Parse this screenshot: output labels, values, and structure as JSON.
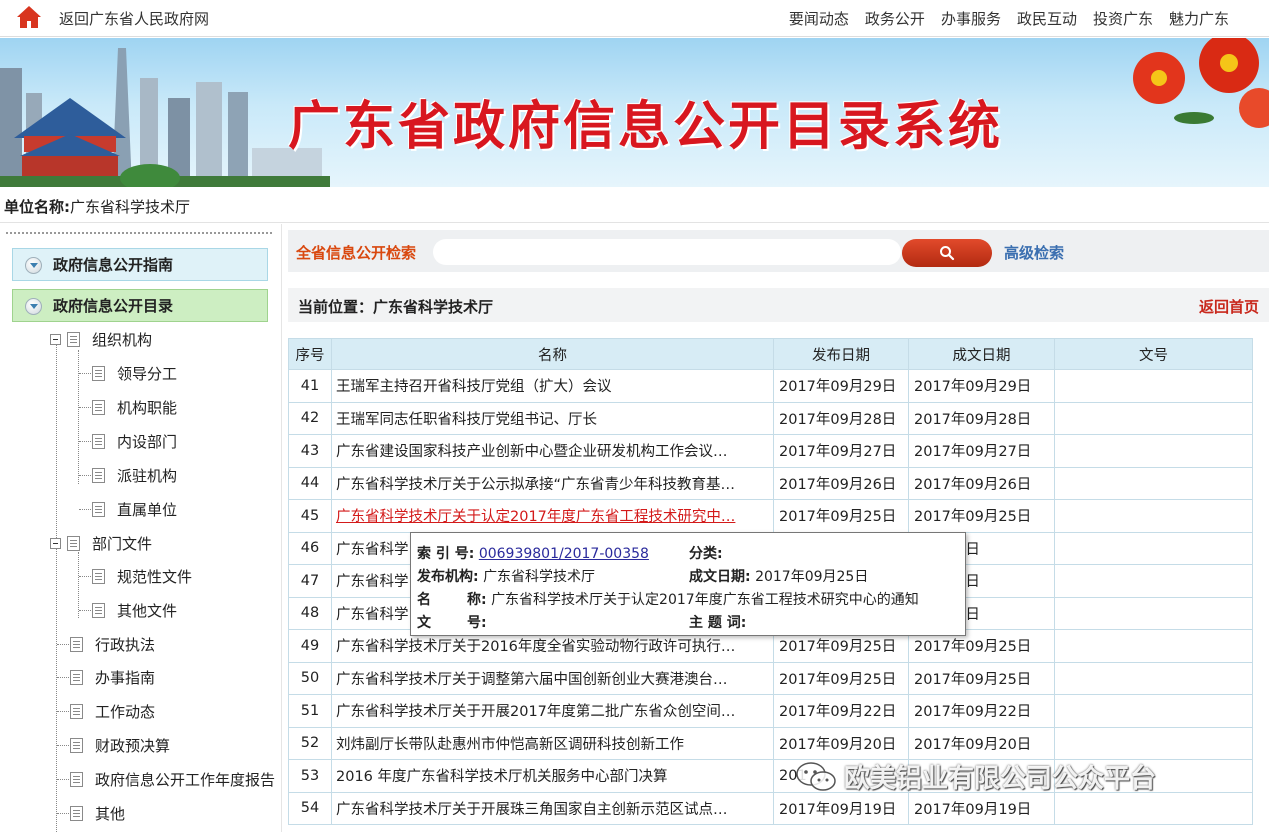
{
  "topbar": {
    "back_link": "返回广东省人民政府网",
    "nav": [
      "要闻动态",
      "政务公开",
      "办事服务",
      "政民互动",
      "投资广东",
      "魅力广东"
    ]
  },
  "banner": {
    "title": "广东省政府信息公开目录系统"
  },
  "unit": {
    "label": "单位名称:",
    "value": "广东省科学技术厅"
  },
  "sidebar": {
    "guide": "政府信息公开指南",
    "catalog": "政府信息公开目录",
    "tree": [
      {
        "label": "组织机构",
        "level": 1
      },
      {
        "label": "领导分工",
        "level": 2
      },
      {
        "label": "机构职能",
        "level": 2
      },
      {
        "label": "内设部门",
        "level": 2
      },
      {
        "label": "派驻机构",
        "level": 2
      },
      {
        "label": "直属单位",
        "level": 2
      },
      {
        "label": "部门文件",
        "level": 1
      },
      {
        "label": "规范性文件",
        "level": 2
      },
      {
        "label": "其他文件",
        "level": 2
      },
      {
        "label": "行政执法",
        "level": 1
      },
      {
        "label": "办事指南",
        "level": 1
      },
      {
        "label": "工作动态",
        "level": 1
      },
      {
        "label": "财政预决算",
        "level": 1
      },
      {
        "label": "政府信息公开工作年度报告",
        "level": 1
      },
      {
        "label": "其他",
        "level": 1
      }
    ]
  },
  "search": {
    "label": "全省信息公开检索",
    "placeholder": "",
    "advanced": "高级检索"
  },
  "location": {
    "text": "当前位置：广东省科学技术厅",
    "home": "返回首页"
  },
  "table": {
    "headers": [
      "序号",
      "名称",
      "发布日期",
      "成文日期",
      "文号"
    ],
    "rows": [
      {
        "no": "41",
        "name": "王瑞军主持召开省科技厅党组（扩大）会议",
        "pub": "2017年09月29日",
        "made": "2017年09月29日",
        "doc": ""
      },
      {
        "no": "42",
        "name": "王瑞军同志任职省科技厅党组书记、厅长",
        "pub": "2017年09月28日",
        "made": "2017年09月28日",
        "doc": ""
      },
      {
        "no": "43",
        "name": "广东省建设国家科技产业创新中心暨企业研发机构工作会议…",
        "pub": "2017年09月27日",
        "made": "2017年09月27日",
        "doc": ""
      },
      {
        "no": "44",
        "name": "广东省科学技术厅关于公示拟承接“广东省青少年科技教育基…",
        "pub": "2017年09月26日",
        "made": "2017年09月26日",
        "doc": ""
      },
      {
        "no": "45",
        "name": "广东省科学技术厅关于认定2017年度广东省工程技术研究中…",
        "pub": "2017年09月25日",
        "made": "2017年09月25日",
        "doc": ""
      },
      {
        "no": "46",
        "name": "广东省科学",
        "pub": "",
        "made": "09月25日",
        "doc": ""
      },
      {
        "no": "47",
        "name": "广东省科学",
        "pub": "",
        "made": "09月25日",
        "doc": ""
      },
      {
        "no": "48",
        "name": "广东省科学",
        "pub": "",
        "made": "09月25日",
        "doc": ""
      },
      {
        "no": "49",
        "name": "广东省科学技术厅关于2016年度全省实验动物行政许可执行…",
        "pub": "2017年09月25日",
        "made": "2017年09月25日",
        "doc": ""
      },
      {
        "no": "50",
        "name": "广东省科学技术厅关于调整第六届中国创新创业大赛港澳台…",
        "pub": "2017年09月25日",
        "made": "2017年09月25日",
        "doc": ""
      },
      {
        "no": "51",
        "name": "广东省科学技术厅关于开展2017年度第二批广东省众创空间…",
        "pub": "2017年09月22日",
        "made": "2017年09月22日",
        "doc": ""
      },
      {
        "no": "52",
        "name": "刘炜副厅长带队赴惠州市仲恺高新区调研科技创新工作",
        "pub": "2017年09月20日",
        "made": "2017年09月20日",
        "doc": ""
      },
      {
        "no": "53",
        "name": "2016 年度广东省科学技术厅机关服务中心部门决算",
        "pub": "201",
        "made": "",
        "doc": ""
      },
      {
        "no": "54",
        "name": "广东省科学技术厅关于开展珠三角国家自主创新示范区试点…",
        "pub": "2017年09月19日",
        "made": "2017年09月19日",
        "doc": ""
      }
    ],
    "highlight_row": 4
  },
  "tooltip": {
    "index_label": "索 引 号:",
    "index_value": "006939801/2017-00358",
    "category_label": "分类:",
    "category_value": "",
    "org_label": "发布机构:",
    "org_value": "广东省科学技术厅",
    "date_label": "成文日期:",
    "date_value": "2017年09月25日",
    "name_label_1": "名",
    "name_label_2": "称:",
    "name_value": "广东省科学技术厅关于认定2017年度广东省工程技术研究中心的通知",
    "doc_label_1": "文",
    "doc_label_2": "号:",
    "doc_value": "",
    "subject_label": "主 题 词:",
    "subject_value": ""
  },
  "watermark": {
    "text": "欧美铝业有限公司公众平台"
  },
  "colors": {
    "accent_red": "#d8171f",
    "link_blue": "#3b6fb0",
    "table_header": "#d7ecf5"
  }
}
